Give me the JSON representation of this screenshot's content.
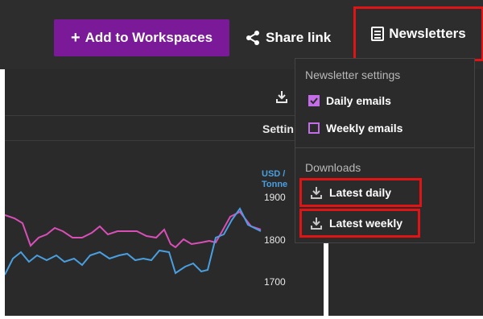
{
  "header": {
    "add_button_label": "Add to Workspaces",
    "share_label": "Share link",
    "newsletters_label": "Newsletters"
  },
  "panel": {
    "settings_label": "Settin",
    "unit_line1": "USD /",
    "unit_line2": "Tonne",
    "ticks": [
      "1900",
      "1800",
      "1700"
    ]
  },
  "dropdown": {
    "newsletter_settings_title": "Newsletter settings",
    "daily_emails_label": "Daily emails",
    "daily_emails_checked": true,
    "weekly_emails_label": "Weekly emails",
    "weekly_emails_checked": false,
    "downloads_title": "Downloads",
    "latest_daily_label": "Latest daily",
    "latest_weekly_label": "Latest weekly"
  },
  "colors": {
    "accent_purple": "#7a1a98",
    "checkbox_purple": "#c46de8",
    "highlight_red": "#e01414",
    "series_pink": "#d94fb8",
    "series_blue": "#4a9fe0"
  }
}
